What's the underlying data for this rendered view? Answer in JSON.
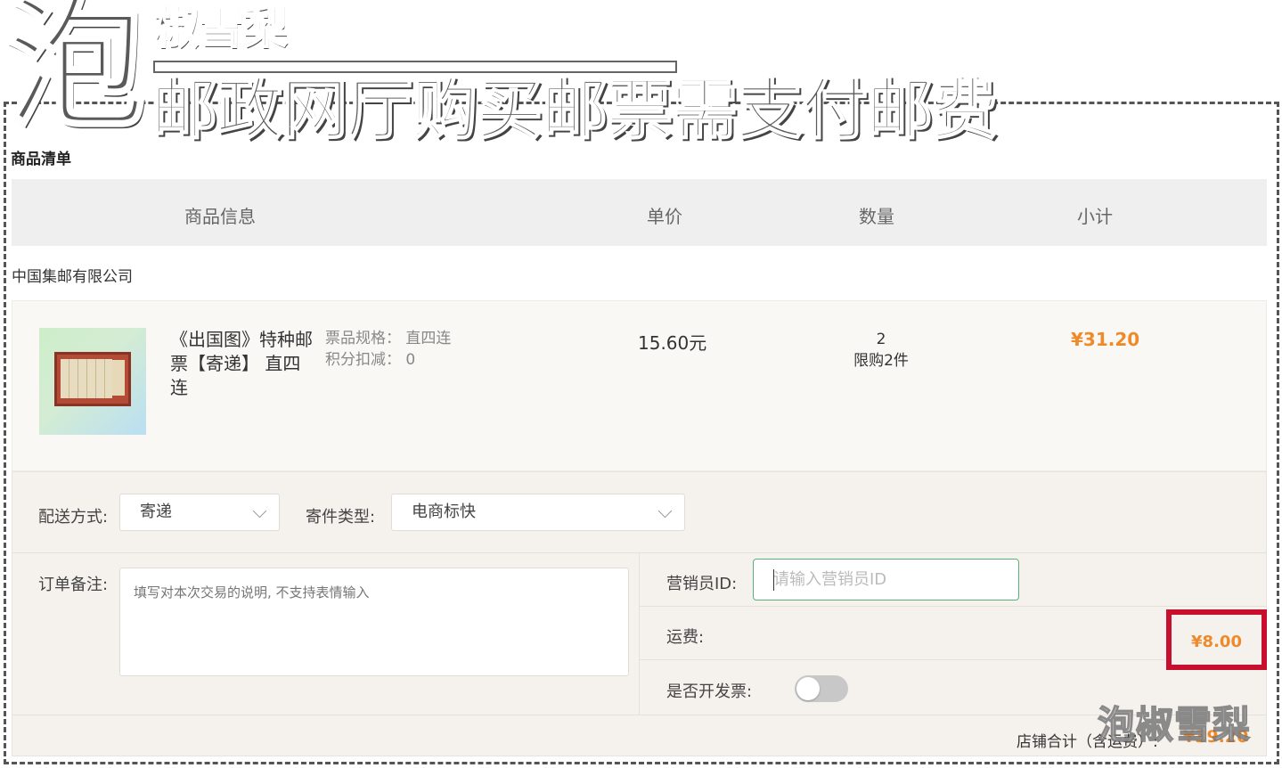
{
  "overlay": {
    "big_char": "泡",
    "brand": "椒雪梨",
    "headline": "邮政网厅购买邮票需支付邮费",
    "watermark": "泡椒雪梨"
  },
  "section_title": "商品清单",
  "table_header": {
    "product_info": "商品信息",
    "unit_price": "单价",
    "quantity": "数量",
    "subtotal": "小计"
  },
  "shop_name": "中国集邮有限公司",
  "product": {
    "name": "《出国图》特种邮票【寄递】 直四连",
    "spec_label": "票品规格：",
    "spec_value": "直四连",
    "points_label": "积分扣减：",
    "points_value": "0",
    "unit_price": "15.60元",
    "quantity": "2",
    "limit": "限购2件",
    "subtotal": "¥31.20"
  },
  "options": {
    "delivery_label": "配送方式:",
    "delivery_value": "寄递",
    "mail_type_label": "寄件类型:",
    "mail_type_value": "电商标快",
    "remark_label": "订单备注:",
    "remark_placeholder": "填写对本次交易的说明, 不支持表情输入",
    "marketer_label": "营销员ID:",
    "marketer_placeholder": "请输入营销员ID",
    "shipping_label": "运费:",
    "shipping_value": "¥8.00",
    "invoice_label": "是否开发票:",
    "invoice_on": false
  },
  "total": {
    "label": "店铺合计（含运费）:",
    "value": "¥39.20"
  },
  "colors": {
    "price_orange": "#ef8a2b",
    "highlight_red": "#c8102e",
    "input_focus_green": "#5bb07a"
  }
}
